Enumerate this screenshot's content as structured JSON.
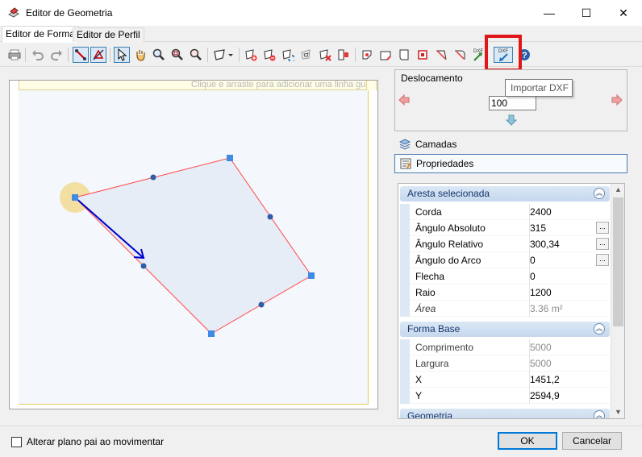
{
  "window": {
    "title": "Editor de Geometria",
    "minimize_glyph": "—",
    "maximize_glyph": "☐",
    "close_glyph": "✕"
  },
  "tabs": [
    {
      "label": "Editor de Forma",
      "active": true
    },
    {
      "label": "Editor de Perfil",
      "active": false
    }
  ],
  "toolbar": {
    "dxf_label": "DXF",
    "highlight_color": "#e0161b"
  },
  "tooltip": "Importar DXF",
  "canvas": {
    "guide_hint": "Clique e arraste para adicionar uma linha guia"
  },
  "deslocamento": {
    "label": "Deslocamento",
    "value": "100"
  },
  "nav": {
    "camadas": "Camadas",
    "propriedades": "Propriedades"
  },
  "properties": {
    "sections": [
      {
        "title": "Aresta selecionada",
        "rows": [
          {
            "name": "Corda",
            "value": "2400"
          },
          {
            "name": "Ângulo Absoluto",
            "value": "315"
          },
          {
            "name": "Ângulo Relativo",
            "value": "300,34"
          },
          {
            "name": "Ângulo do Arco",
            "value": "0"
          },
          {
            "name": "Flecha",
            "value": "0"
          },
          {
            "name": "Raio",
            "value": "1200"
          },
          {
            "name": "Área",
            "value": "3.36 m²"
          }
        ]
      },
      {
        "title": "Forma Base",
        "rows": [
          {
            "name": "Comprimento",
            "value": "5000"
          },
          {
            "name": "Largura",
            "value": "5000"
          },
          {
            "name": "X",
            "value": "1451,2"
          },
          {
            "name": "Y",
            "value": "2594,9"
          }
        ]
      },
      {
        "title": "Geometria",
        "rows": []
      }
    ],
    "ellipsis": "..."
  },
  "footer": {
    "checkbox_label": "Alterar plano pai ao movimentar",
    "checkbox_checked": false,
    "ok_label": "OK",
    "cancel_label": "Cancelar"
  },
  "colors": {
    "accent": "#0078d7",
    "polygon_edge": "#ff4b4b",
    "selected_edge": "#0000cc",
    "polygon_fill": "#e6edf6"
  }
}
